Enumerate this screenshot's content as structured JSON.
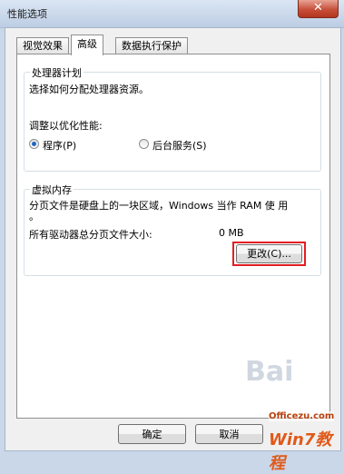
{
  "window": {
    "title": "性能选项",
    "close_glyph": "✕"
  },
  "tabs": [
    {
      "label": "视觉效果",
      "active": false
    },
    {
      "label": "高级",
      "active": true
    },
    {
      "label": "数据执行保护",
      "active": false
    }
  ],
  "cpu_group": {
    "title": "处理器计划",
    "description": "选择如何分配处理器资源。",
    "optimize_label": "调整以优化性能:",
    "option_programs": "程序(P)",
    "option_background": "后台服务(S)",
    "selected": "programs"
  },
  "vm_group": {
    "title": "虚拟内存",
    "description_line1": "分页文件是硬盘上的一块区域，Windows 当作 RAM 使 用",
    "description_line2": "。",
    "total_label": "所有驱动器总分页文件大小:",
    "total_value": "0 MB",
    "change_button": "更改(C)...",
    "highlight_color": "#e21e25"
  },
  "footer": {
    "ok_button": "确定",
    "cancel_button": "取消"
  },
  "watermarks": {
    "baidu": "Bai",
    "site": "Officezu.com",
    "win7": "Win7教程"
  }
}
